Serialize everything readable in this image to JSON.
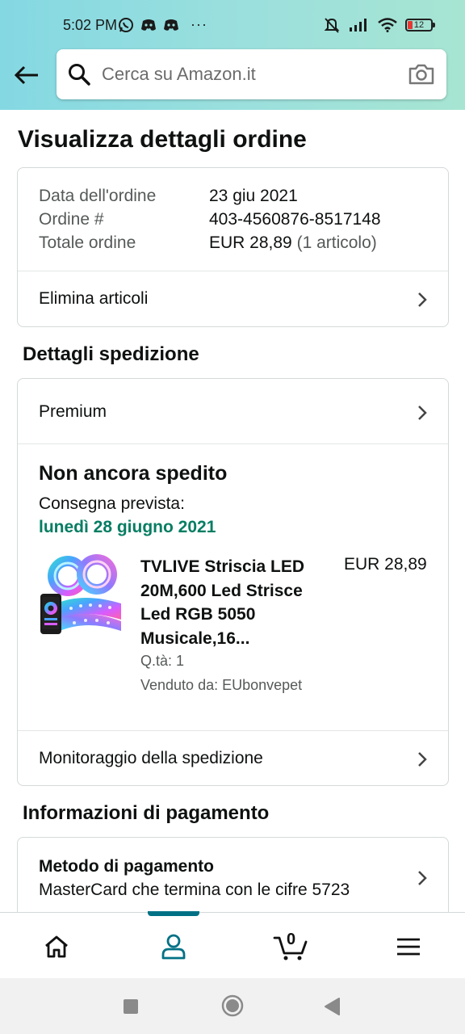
{
  "status_bar": {
    "time": "5:02 PM",
    "dots": "···",
    "battery": "12"
  },
  "search": {
    "placeholder": "Cerca su Amazon.it"
  },
  "page": {
    "title": "Visualizza dettagli ordine"
  },
  "order": {
    "rows": [
      {
        "label": "Data dell'ordine",
        "value": "23 giu 2021"
      },
      {
        "label": "Ordine #",
        "value": "403-4560876-8517148"
      },
      {
        "label": "Totale ordine",
        "value": "EUR 28,89",
        "extra": "(1 articolo)"
      }
    ],
    "delete_items_label": "Elimina articoli"
  },
  "shipping": {
    "section_title": "Dettagli spedizione",
    "method": "Premium",
    "status": "Non ancora spedito",
    "delivery_label": "Consegna prevista:",
    "delivery_date": "lunedì 28 giugno 2021",
    "product": {
      "title": "TVLIVE Striscia LED 20M,600 Led Strisce Led RGB 5050 Musicale,16...",
      "price": "EUR 28,89",
      "qty": "Q.tà: 1",
      "seller": "Venduto da: EUbonvepet"
    },
    "tracking_label": "Monitoraggio della spedizione"
  },
  "payment": {
    "section_title": "Informazioni di pagamento",
    "method_title": "Metodo di pagamento",
    "method_value": "MasterCard che termina con le cifre 5723"
  },
  "bottom_nav": {
    "cart_count": "0",
    "active": "account",
    "accent": "#007185"
  },
  "colors": {
    "delivery_green": "#067d62",
    "header_gradient_start": "#84d8e2",
    "header_gradient_end": "#a7e5d2"
  }
}
